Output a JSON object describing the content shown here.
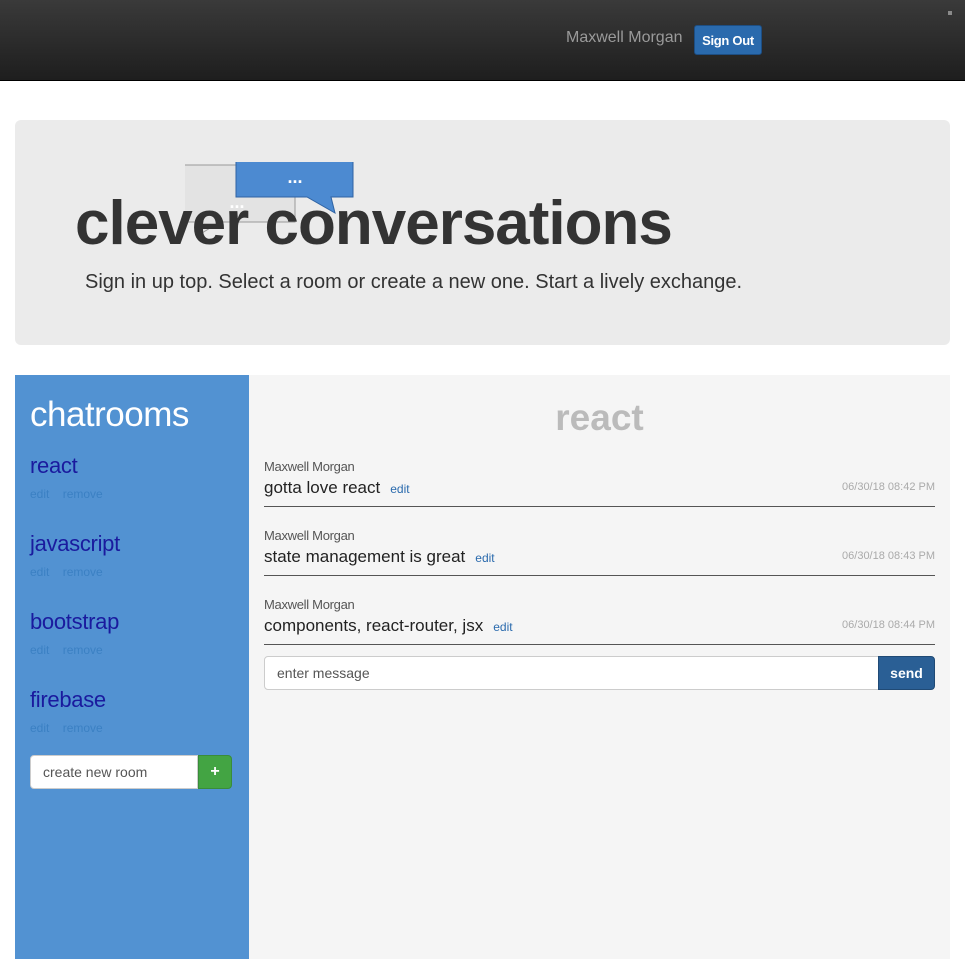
{
  "navbar": {
    "user_name": "Maxwell Morgan",
    "sign_out_label": "Sign Out"
  },
  "jumbotron": {
    "title": "clever conversations",
    "subtitle": "Sign in up top. Select a room or create a new one. Start a lively exchange.",
    "logo_bubbles": [
      "...",
      "..."
    ]
  },
  "sidebar": {
    "title": "chatrooms",
    "rooms": [
      {
        "name": "react",
        "edit": "edit",
        "remove": "remove"
      },
      {
        "name": "javascript",
        "edit": "edit",
        "remove": "remove"
      },
      {
        "name": "bootstrap",
        "edit": "edit",
        "remove": "remove"
      },
      {
        "name": "firebase",
        "edit": "edit",
        "remove": "remove"
      }
    ],
    "new_room_placeholder": "create new room",
    "new_room_button": "+"
  },
  "chat": {
    "room_title": "react",
    "messages": [
      {
        "user": "Maxwell Morgan",
        "content": "gotta love react",
        "edit": "edit",
        "time": "06/30/18 08:42 PM"
      },
      {
        "user": "Maxwell Morgan",
        "content": "state management is great",
        "edit": "edit",
        "time": "06/30/18 08:43 PM"
      },
      {
        "user": "Maxwell Morgan",
        "content": "components, react-router, jsx",
        "edit": "edit",
        "time": "06/30/18 08:44 PM"
      }
    ],
    "input_placeholder": "enter message",
    "send_label": "send"
  },
  "colors": {
    "navbar": "#2b2b2b",
    "sidebar": "#5292d2",
    "primary_button": "#2a6aad",
    "add_button": "#43a443",
    "room_link": "#1a1a9e"
  }
}
